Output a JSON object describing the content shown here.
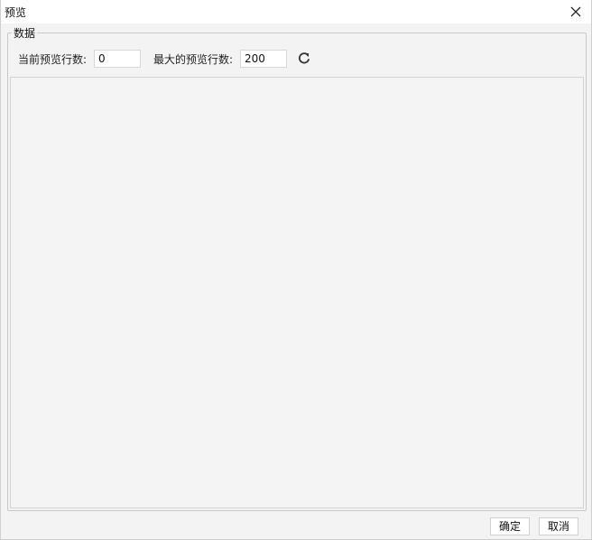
{
  "window": {
    "title": "预览",
    "close_icon": "close-icon"
  },
  "data_group": {
    "legend": "数据",
    "current_rows_label": "当前预览行数:",
    "current_rows_value": "0",
    "max_rows_label": "最大的预览行数:",
    "max_rows_value": "200",
    "refresh_icon": "refresh-icon"
  },
  "footer": {
    "ok_label": "确定",
    "cancel_label": "取消"
  }
}
